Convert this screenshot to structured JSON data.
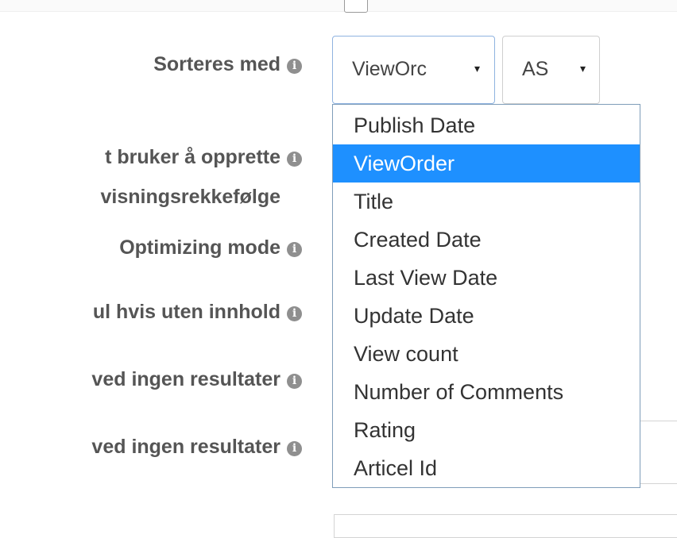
{
  "form": {
    "labels": [
      "Sorteres med",
      "t bruker å opprette",
      "visningsrekkefølge",
      "Optimizing mode",
      "ul hvis uten innhold",
      "ved ingen resultater",
      "ved ingen resultater"
    ],
    "info_icon_glyph": "i"
  },
  "sort_field_select": {
    "value": "ViewOrc",
    "caret": "▾"
  },
  "sort_direction_select": {
    "value": "AS",
    "caret": "▾"
  },
  "dropdown": {
    "selected_index": 1,
    "selected_color": "#1e90ff",
    "options": [
      "Publish Date",
      "ViewOrder",
      "Title",
      "Created Date",
      "Last View Date",
      "Update Date",
      "View count",
      "Number of Comments",
      "Rating",
      "Articel Id"
    ]
  }
}
